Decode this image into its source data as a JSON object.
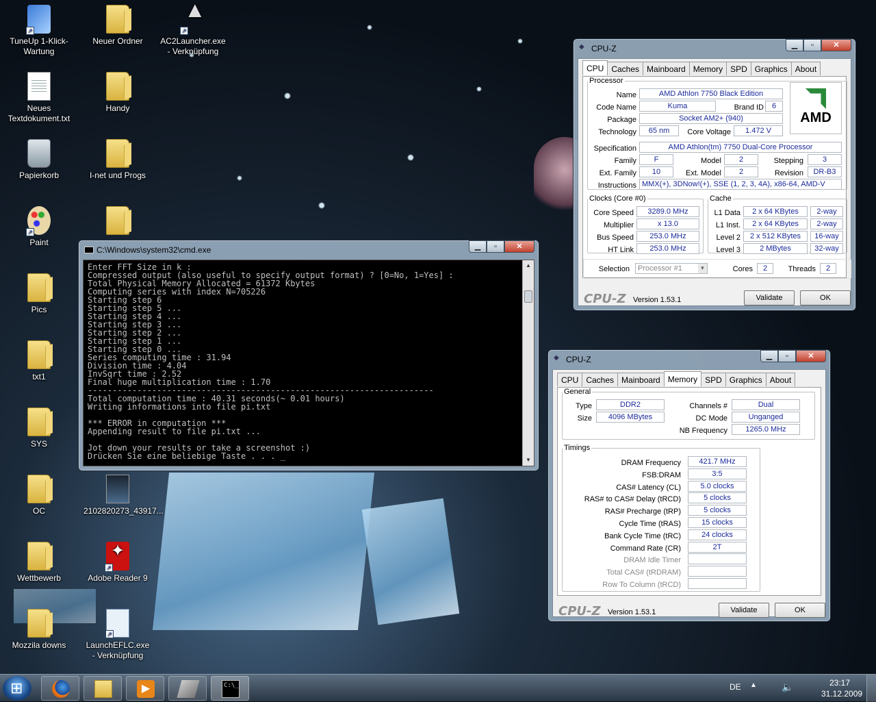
{
  "desktop": {
    "icons": [
      {
        "label": "TuneUp 1-Klick-Wartung",
        "type": "tune",
        "shortcut": true
      },
      {
        "label": "Neuer Ordner",
        "type": "folder"
      },
      {
        "label": "AC2Launcher.exe - Verknüpfung",
        "type": "ac",
        "shortcut": true
      },
      {
        "label": "Neues Textdokument.txt",
        "type": "doc"
      },
      {
        "label": "Handy",
        "type": "folder"
      },
      {
        "label": "Papierkorb",
        "type": "bin"
      },
      {
        "label": "I-net und Progs",
        "type": "folder"
      },
      {
        "label": "Paint",
        "type": "palette",
        "shortcut": true
      },
      {
        "label": "",
        "type": "folder"
      },
      {
        "label": "Pics",
        "type": "folder"
      },
      {
        "label": "txt1",
        "type": "folder"
      },
      {
        "label": "SYS",
        "type": "folder"
      },
      {
        "label": "OC",
        "type": "folder"
      },
      {
        "label": "2102820273_43917...",
        "type": "thumb"
      },
      {
        "label": "Wettbewerb",
        "type": "folder"
      },
      {
        "label": "Adobe Reader 9",
        "type": "pdf",
        "shortcut": true
      },
      {
        "label": "Mozzila downs",
        "type": "folder"
      },
      {
        "label": "LaunchEFLC.exe - Verknüpfung",
        "type": "launch",
        "shortcut": true
      }
    ]
  },
  "cmd": {
    "title": "C:\\Windows\\system32\\cmd.exe",
    "lines": [
      "Enter FFT Size in k :",
      "Compressed output (also useful to specify output format) ? [0=No, 1=Yes] :",
      "Total Physical Memory Allocated = 61372 Kbytes",
      "Computing series with index N=705226",
      "Starting step 6",
      "Starting step 5 ...",
      "Starting step 4 ...",
      "Starting step 3 ...",
      "Starting step 2 ...",
      "Starting step 1 ...",
      "Starting step 0 ...",
      "Series computing time : 31.94",
      "Division time : 4.04",
      "InvSqrt time : 2.52",
      "Final huge multiplication time : 1.70",
      "----------------------------------------------------------------------",
      "Total computation time : 40.31 seconds(~ 0.01 hours)",
      "Writing informations into file pi.txt",
      "",
      "*** ERROR in computation ***",
      "Appending result to file pi.txt ...",
      "",
      "Jot down your results or take a screenshot :)",
      "Drücken Sie eine beliebige Taste . . . _"
    ]
  },
  "cpuz1": {
    "title": "CPU-Z",
    "tabs": [
      "CPU",
      "Caches",
      "Mainboard",
      "Memory",
      "SPD",
      "Graphics",
      "About"
    ],
    "processor": {
      "legend": "Processor",
      "name_l": "Name",
      "name": "AMD Athlon 7750 Black Edition",
      "code_l": "Code Name",
      "code": "Kuma",
      "brand_l": "Brand ID",
      "brand": "6",
      "pkg_l": "Package",
      "pkg": "Socket AM2+ (940)",
      "tech_l": "Technology",
      "tech": "65 nm",
      "volt_l": "Core Voltage",
      "volt": "1.472 V",
      "spec_l": "Specification",
      "spec": "AMD Athlon(tm) 7750 Dual-Core Processor",
      "fam_l": "Family",
      "fam": "F",
      "model_l": "Model",
      "model": "2",
      "step_l": "Stepping",
      "step": "3",
      "efam_l": "Ext. Family",
      "efam": "10",
      "emodel_l": "Ext. Model",
      "emodel": "2",
      "rev_l": "Revision",
      "rev": "DR-B3",
      "instr_l": "Instructions",
      "instr": "MMX(+), 3DNow!(+), SSE (1, 2, 3, 4A), x86-64, AMD-V",
      "logo": "AMD"
    },
    "clocks": {
      "legend": "Clocks (Core #0)",
      "core_l": "Core Speed",
      "core": "3289.0 MHz",
      "mult_l": "Multiplier",
      "mult": "x 13.0",
      "bus_l": "Bus Speed",
      "bus": "253.0 MHz",
      "ht_l": "HT Link",
      "ht": "253.0 MHz"
    },
    "cache": {
      "legend": "Cache",
      "l1d_l": "L1 Data",
      "l1d": "2 x 64 KBytes",
      "l1d_w": "2-way",
      "l1i_l": "L1 Inst.",
      "l1i": "2 x 64 KBytes",
      "l1i_w": "2-way",
      "l2_l": "Level 2",
      "l2": "2 x 512 KBytes",
      "l2_w": "16-way",
      "l3_l": "Level 3",
      "l3": "2 MBytes",
      "l3_w": "32-way"
    },
    "sel_l": "Selection",
    "sel": "Processor #1",
    "cores_l": "Cores",
    "cores": "2",
    "threads_l": "Threads",
    "threads": "2",
    "logo": "CPU-Z",
    "version": "Version 1.53.1",
    "validate": "Validate",
    "ok": "OK"
  },
  "cpuz2": {
    "title": "CPU-Z",
    "tabs": [
      "CPU",
      "Caches",
      "Mainboard",
      "Memory",
      "SPD",
      "Graphics",
      "About"
    ],
    "general": {
      "legend": "General",
      "type_l": "Type",
      "type": "DDR2",
      "size_l": "Size",
      "size": "4096 MBytes",
      "ch_l": "Channels #",
      "ch": "Dual",
      "dc_l": "DC Mode",
      "dc": "Unganged",
      "nb_l": "NB Frequency",
      "nb": "1265.0 MHz"
    },
    "timings": {
      "legend": "Timings",
      "rows": [
        {
          "l": "DRAM Frequency",
          "v": "421.7 MHz"
        },
        {
          "l": "FSB:DRAM",
          "v": "3:5"
        },
        {
          "l": "CAS# Latency (CL)",
          "v": "5.0 clocks"
        },
        {
          "l": "RAS# to CAS# Delay (tRCD)",
          "v": "5 clocks"
        },
        {
          "l": "RAS# Precharge (tRP)",
          "v": "5 clocks"
        },
        {
          "l": "Cycle Time (tRAS)",
          "v": "15 clocks"
        },
        {
          "l": "Bank Cycle Time (tRC)",
          "v": "24 clocks"
        },
        {
          "l": "Command Rate (CR)",
          "v": "2T"
        },
        {
          "l": "DRAM Idle Timer",
          "v": ""
        },
        {
          "l": "Total CAS# (tRDRAM)",
          "v": ""
        },
        {
          "l": "Row To Column (tRCD)",
          "v": ""
        }
      ]
    },
    "logo": "CPU-Z",
    "version": "Version 1.53.1",
    "validate": "Validate",
    "ok": "OK"
  },
  "taskbar": {
    "lang": "DE",
    "time": "23:17",
    "date": "31.12.2009",
    "items": [
      "firefox-icon",
      "explorer-icon",
      "media-player-icon",
      "windows-update-icon",
      "cmd-icon"
    ]
  }
}
